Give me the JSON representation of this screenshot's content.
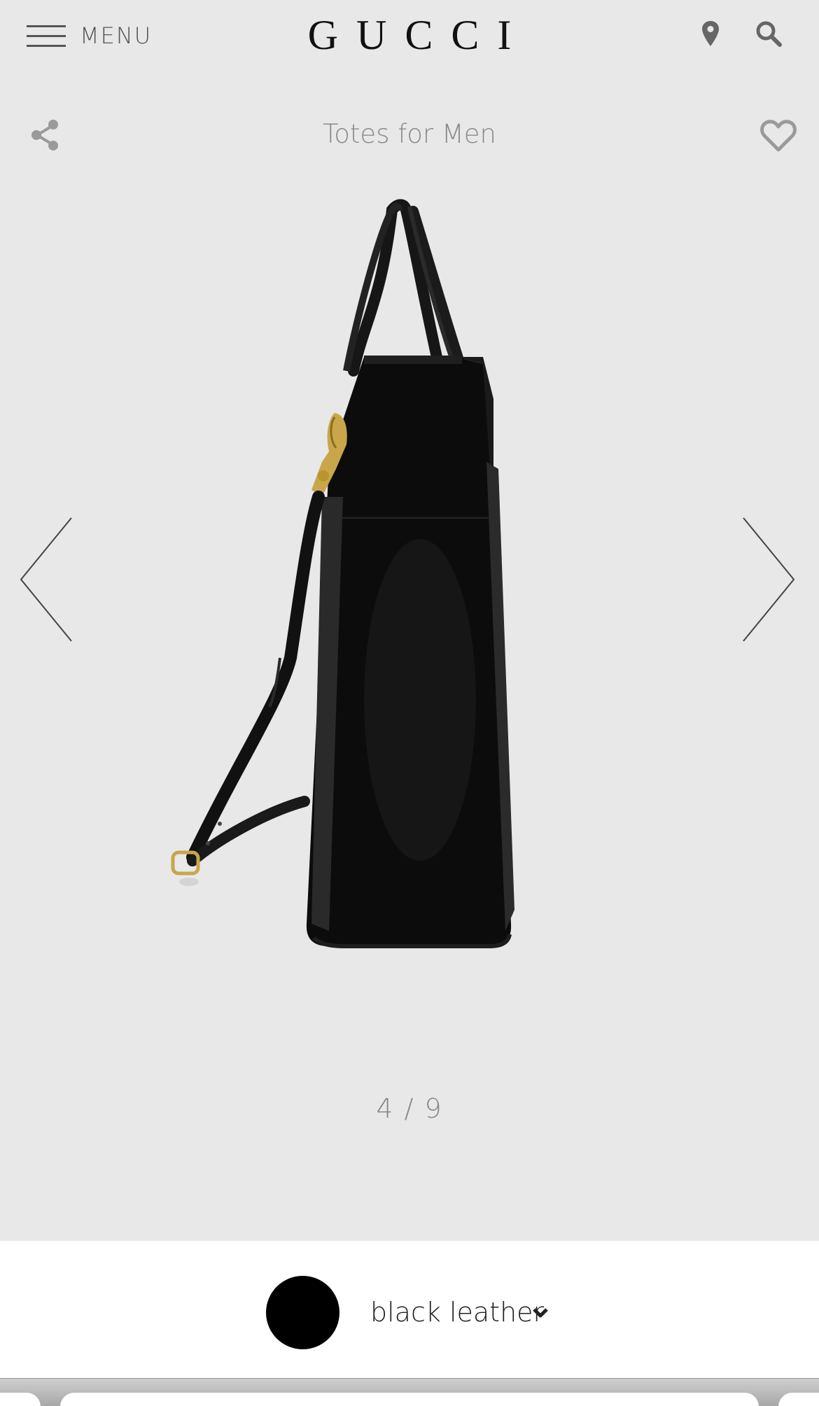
{
  "header": {
    "menu_label": "MENU",
    "logo": "GUCCI"
  },
  "subheader": {
    "category_title": "Totes for Men"
  },
  "gallery": {
    "counter": "4 / 9",
    "current_index": 4,
    "total": 9
  },
  "variant": {
    "label": "black leather",
    "swatch_color": "#000000"
  },
  "colors": {
    "background": "#e8e8e8",
    "accent": "#111111",
    "muted_text": "#8a8a8a"
  }
}
